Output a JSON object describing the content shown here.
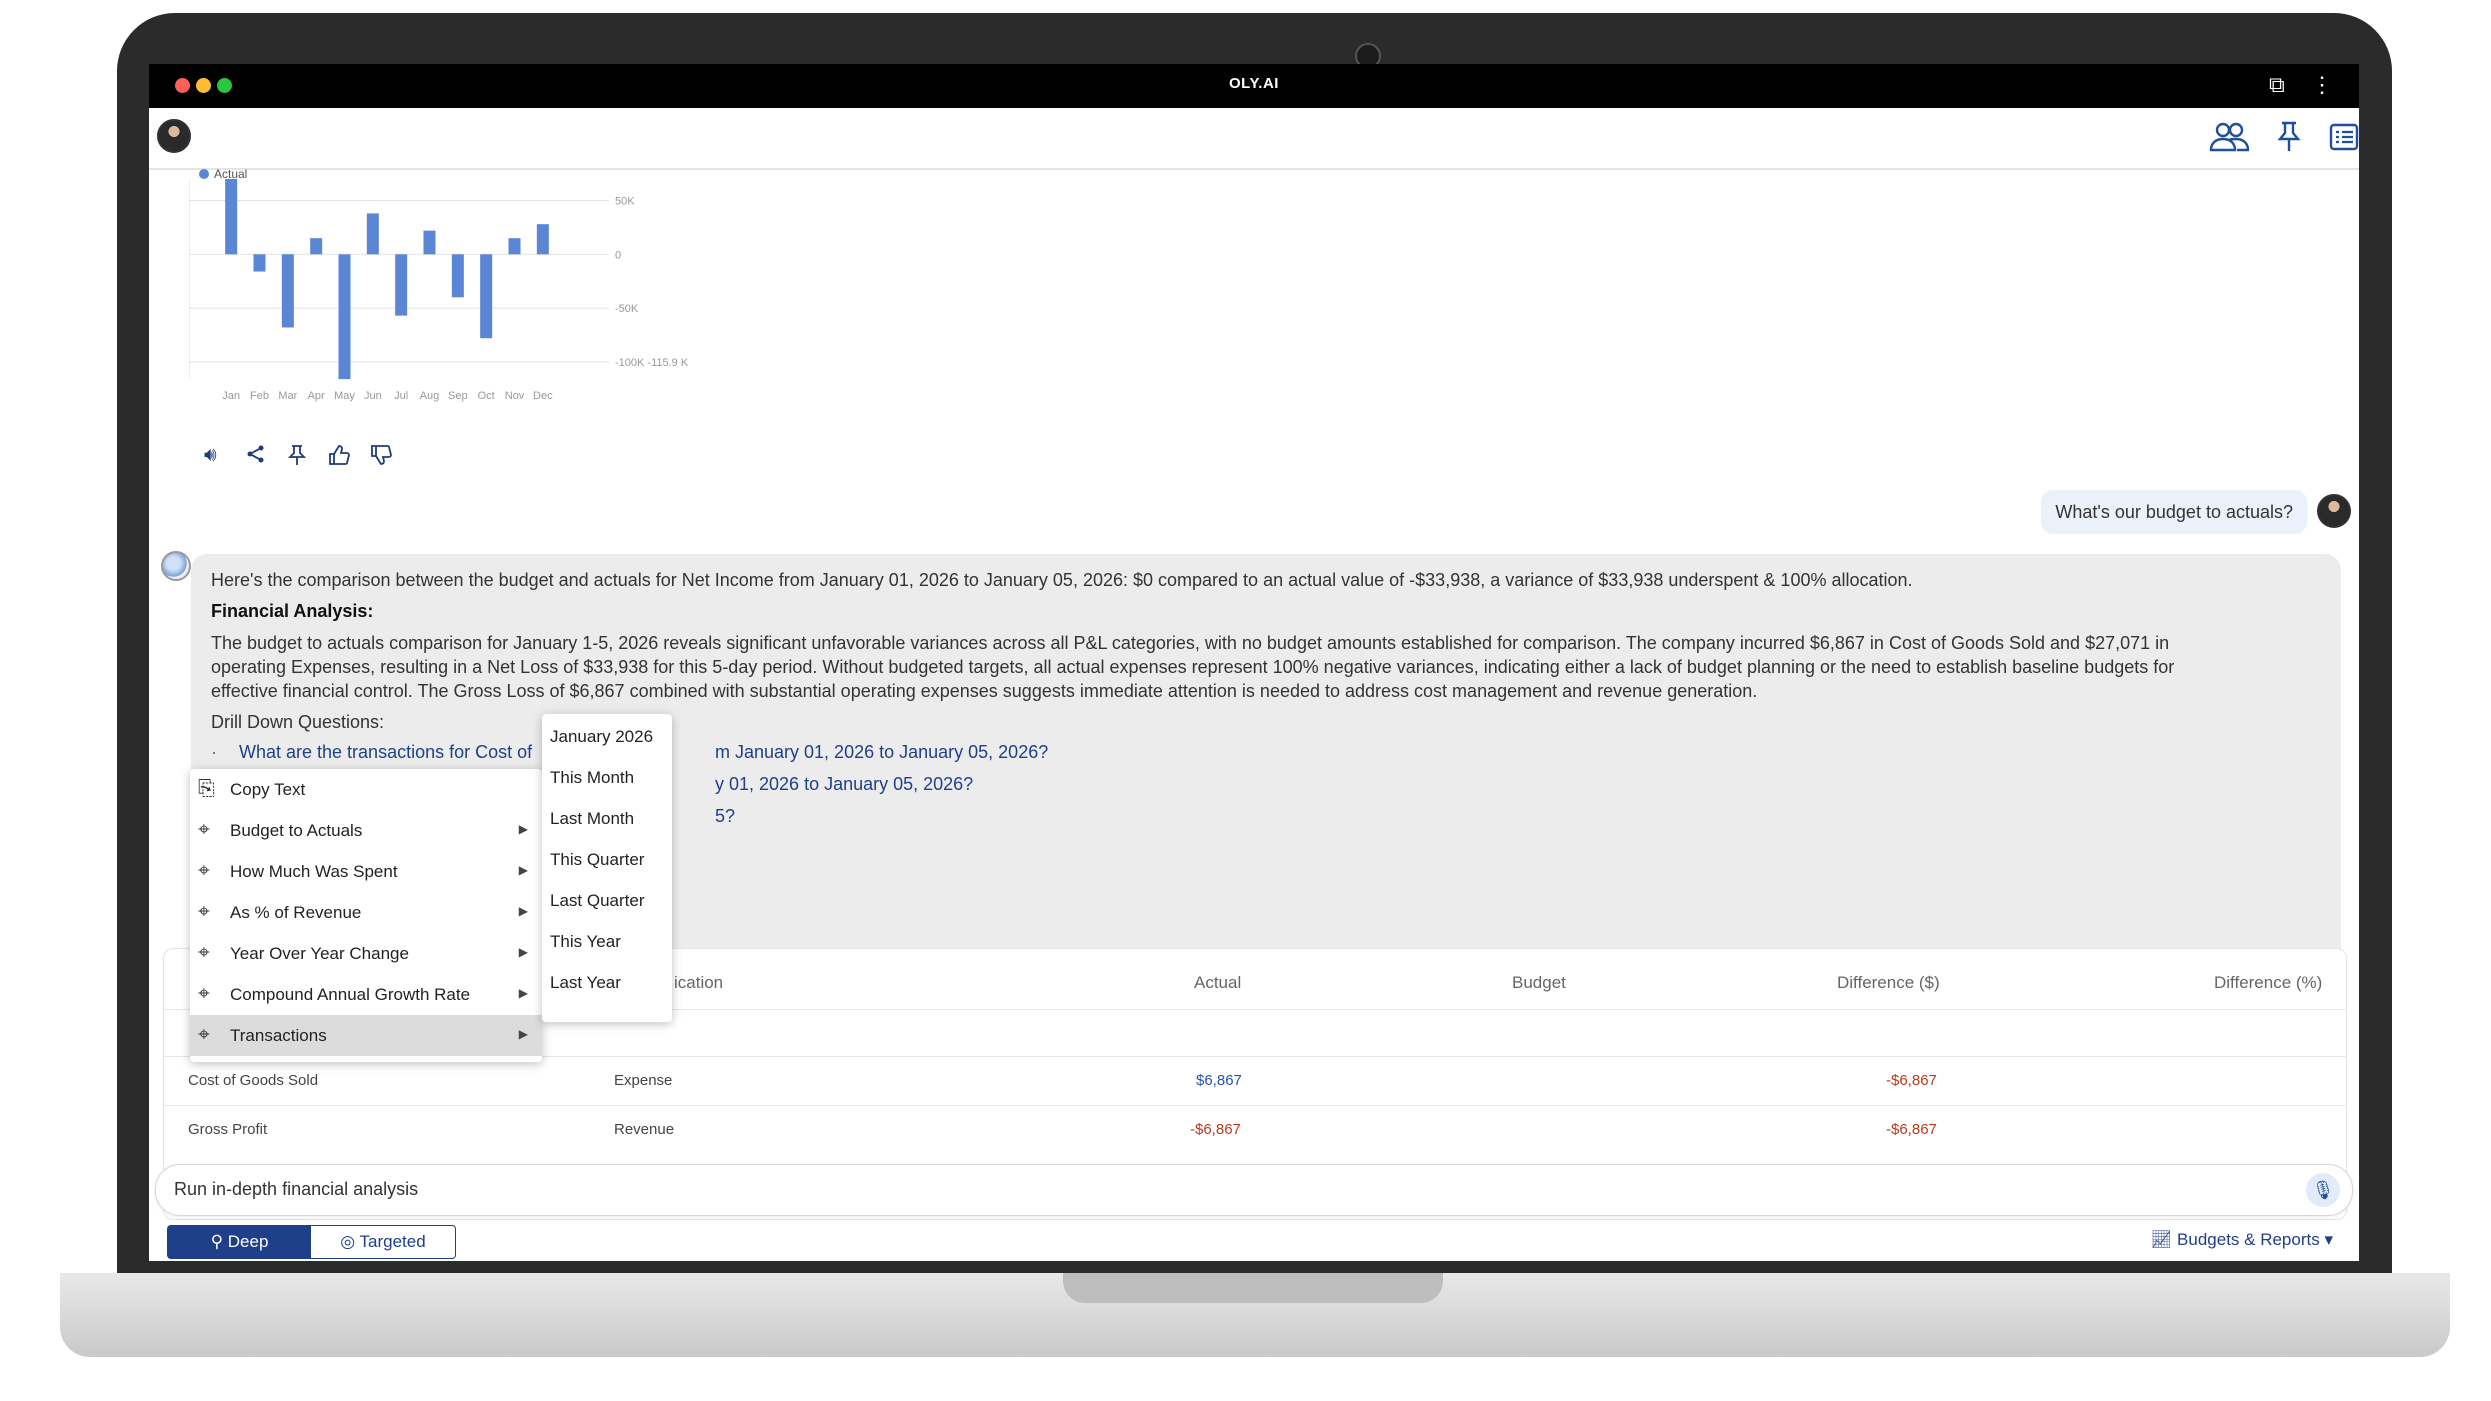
{
  "window": {
    "title": "OLY.AI"
  },
  "header": {
    "icons": [
      "users-icon",
      "pin-icon",
      "list-icon",
      "menu-circle-icon"
    ]
  },
  "chart_data": {
    "type": "bar",
    "legend": [
      "Actual"
    ],
    "categories": [
      "Jan",
      "Feb",
      "Mar",
      "Apr",
      "May",
      "Jun",
      "Jul",
      "Aug",
      "Sep",
      "Oct",
      "Nov",
      "Dec"
    ],
    "series": [
      {
        "name": "Actual",
        "values": [
          70000,
          -16000,
          -68000,
          15000,
          -116000,
          38000,
          -57000,
          22000,
          -40000,
          -78000,
          15000,
          28000
        ]
      }
    ],
    "yticks": [
      "50K",
      "0",
      "-50K",
      "-100K -115.9 K"
    ],
    "ylim": [
      -115900,
      70000
    ],
    "colors": {
      "bar": "#5b86d6"
    }
  },
  "chat": {
    "user_question": "What's our budget to actuals?",
    "summary": "Here's the comparison between the budget and actuals for Net Income from January 01, 2026 to January 05, 2026: $0 compared to an actual value of -$33,938, a variance of $33,938 underspent & 100% allocation.",
    "analysis_heading": "Financial Analysis:",
    "analysis_body_1": "The budget to actuals comparison for January 1-5, 2026 reveals significant unfavorable variances across all P&L categories, with no budget amounts established for comparison. The company incurred $6,867 in Cost of Goods Sold and $27,071 in",
    "analysis_body_2": "operating Expenses, resulting in a Net Loss of $33,938 for this 5-day period. Without budgeted targets, all actual expenses represent 100% negative variances, indicating either a lack of budget planning or the need to establish baseline budgets for",
    "analysis_body_3": "effective financial control. The Gross Loss of $6,867 combined with substantial operating expenses suggests immediate attention is needed to address cost management and revenue generation.",
    "drill_heading": "Drill Down Questions:",
    "drill_1_a": "What are the transactions for Cost of",
    "drill_1_b": "m January 01, 2026 to January 05, 2026?",
    "drill_2_b": "y 01, 2026 to January 05, 2026?",
    "drill_3_b": "5?"
  },
  "context_menu": {
    "items": [
      {
        "label": "Copy Text",
        "icon": "copy-icon"
      },
      {
        "label": "Budget to Actuals",
        "icon": "crosshair-icon"
      },
      {
        "label": "How Much Was Spent",
        "icon": "crosshair-icon"
      },
      {
        "label": "As % of Revenue",
        "icon": "crosshair-icon"
      },
      {
        "label": "Year Over Year Change",
        "icon": "crosshair-icon"
      },
      {
        "label": "Compound Annual Growth Rate",
        "icon": "crosshair-icon"
      },
      {
        "label": "Transactions",
        "icon": "crosshair-icon"
      }
    ]
  },
  "sub_menu": {
    "items": [
      "January 2026",
      "This Month",
      "Last Month",
      "This Quarter",
      "Last Quarter",
      "This Year",
      "Last Year"
    ]
  },
  "table": {
    "headers": [
      "ication",
      "Actual",
      "Budget",
      "Difference ($)",
      "Difference (%)"
    ],
    "rows": [
      {
        "name": "Cost of Goods Sold",
        "classification": "Expense",
        "actual": "$6,867",
        "difference": "-$6,867"
      },
      {
        "name": "Gross Profit",
        "classification": "Revenue",
        "actual": "-$6,867",
        "difference": "-$6,867"
      }
    ]
  },
  "composer": {
    "input_value": "Run in-depth financial analysis",
    "mode_deep": "Deep",
    "mode_targeted": "Targeted",
    "scope": "Budgets & Reports"
  }
}
